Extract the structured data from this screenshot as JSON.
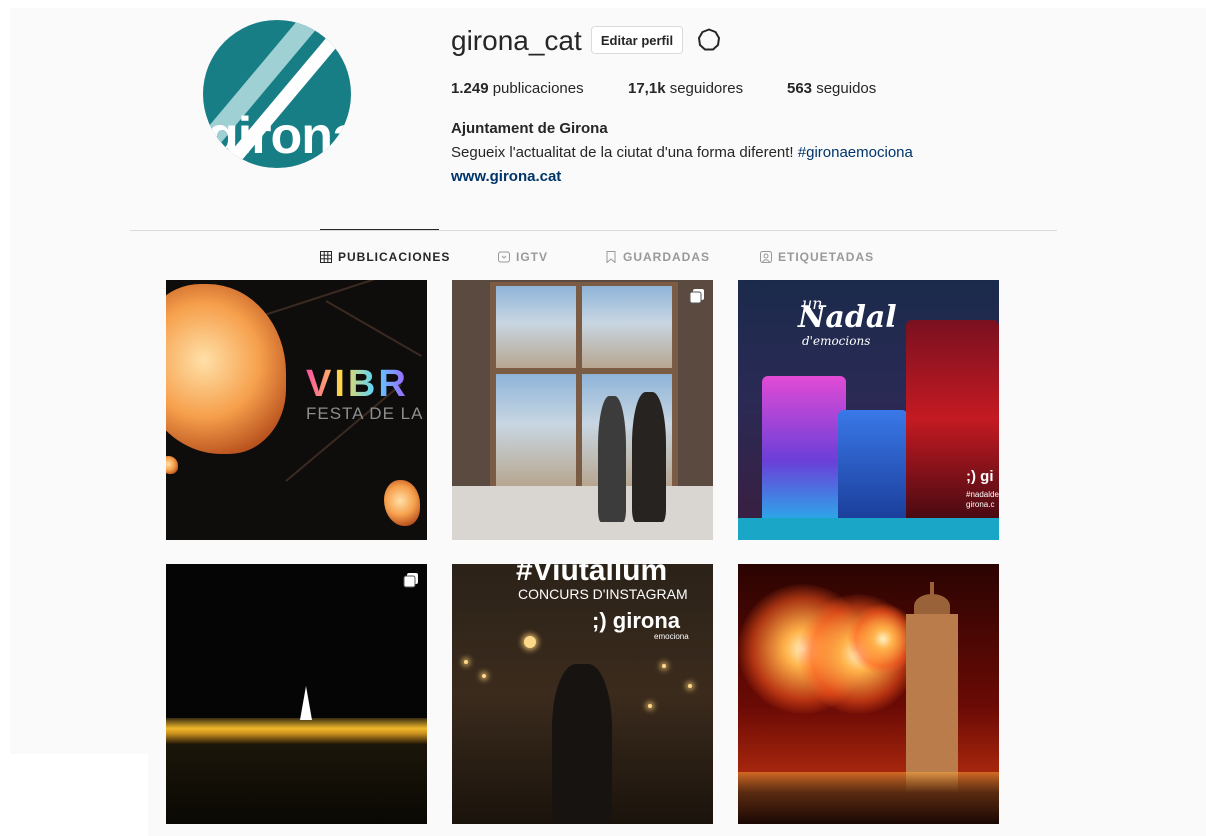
{
  "profile": {
    "username": "girona_cat",
    "edit_label": "Editar perfil",
    "avatar_text": "girona",
    "stats": {
      "posts_count": "1.249",
      "posts_label": "publicaciones",
      "followers_count": "17,1k",
      "followers_label": "seguidores",
      "following_count": "563",
      "following_label": "seguidos"
    },
    "full_name": "Ajuntament de Girona",
    "bio_text": "Segueix l'actualitat de la ciutat d'una forma diferent! ",
    "bio_hashtag": "#gironaemociona",
    "website": "www.girona.cat"
  },
  "tabs": [
    {
      "label": "PUBLICACIONES",
      "icon": "grid-icon",
      "active": true
    },
    {
      "label": "IGTV",
      "icon": "igtv-icon",
      "active": false
    },
    {
      "label": "GUARDADAS",
      "icon": "bookmark-icon",
      "active": false
    },
    {
      "label": "ETIQUETADAS",
      "icon": "tag-person-icon",
      "active": false
    }
  ],
  "posts": [
    {
      "overlay_title": "VIBR",
      "overlay_sub": "FESTA DE LA LL",
      "multi": false
    },
    {
      "multi": true
    },
    {
      "overlay_small": "un",
      "overlay_title": "Nadal",
      "overlay_sub": "d'emocions",
      "corner_tag": ";) gi",
      "corner_sub1": "#nadalde",
      "corner_sub2": "girona.c",
      "multi": false
    },
    {
      "multi": true
    },
    {
      "overlay_title": "#Viutallum",
      "overlay_sub": "CONCURS D'INSTAGRAM",
      "logo": ";) girona",
      "logo_sub": "emociona",
      "multi": false
    },
    {
      "multi": false
    }
  ],
  "colors": {
    "text": "#262626",
    "secondary": "#999999",
    "link": "#003569",
    "divider": "#dbdbdb",
    "avatar_bg": "#187e86"
  }
}
